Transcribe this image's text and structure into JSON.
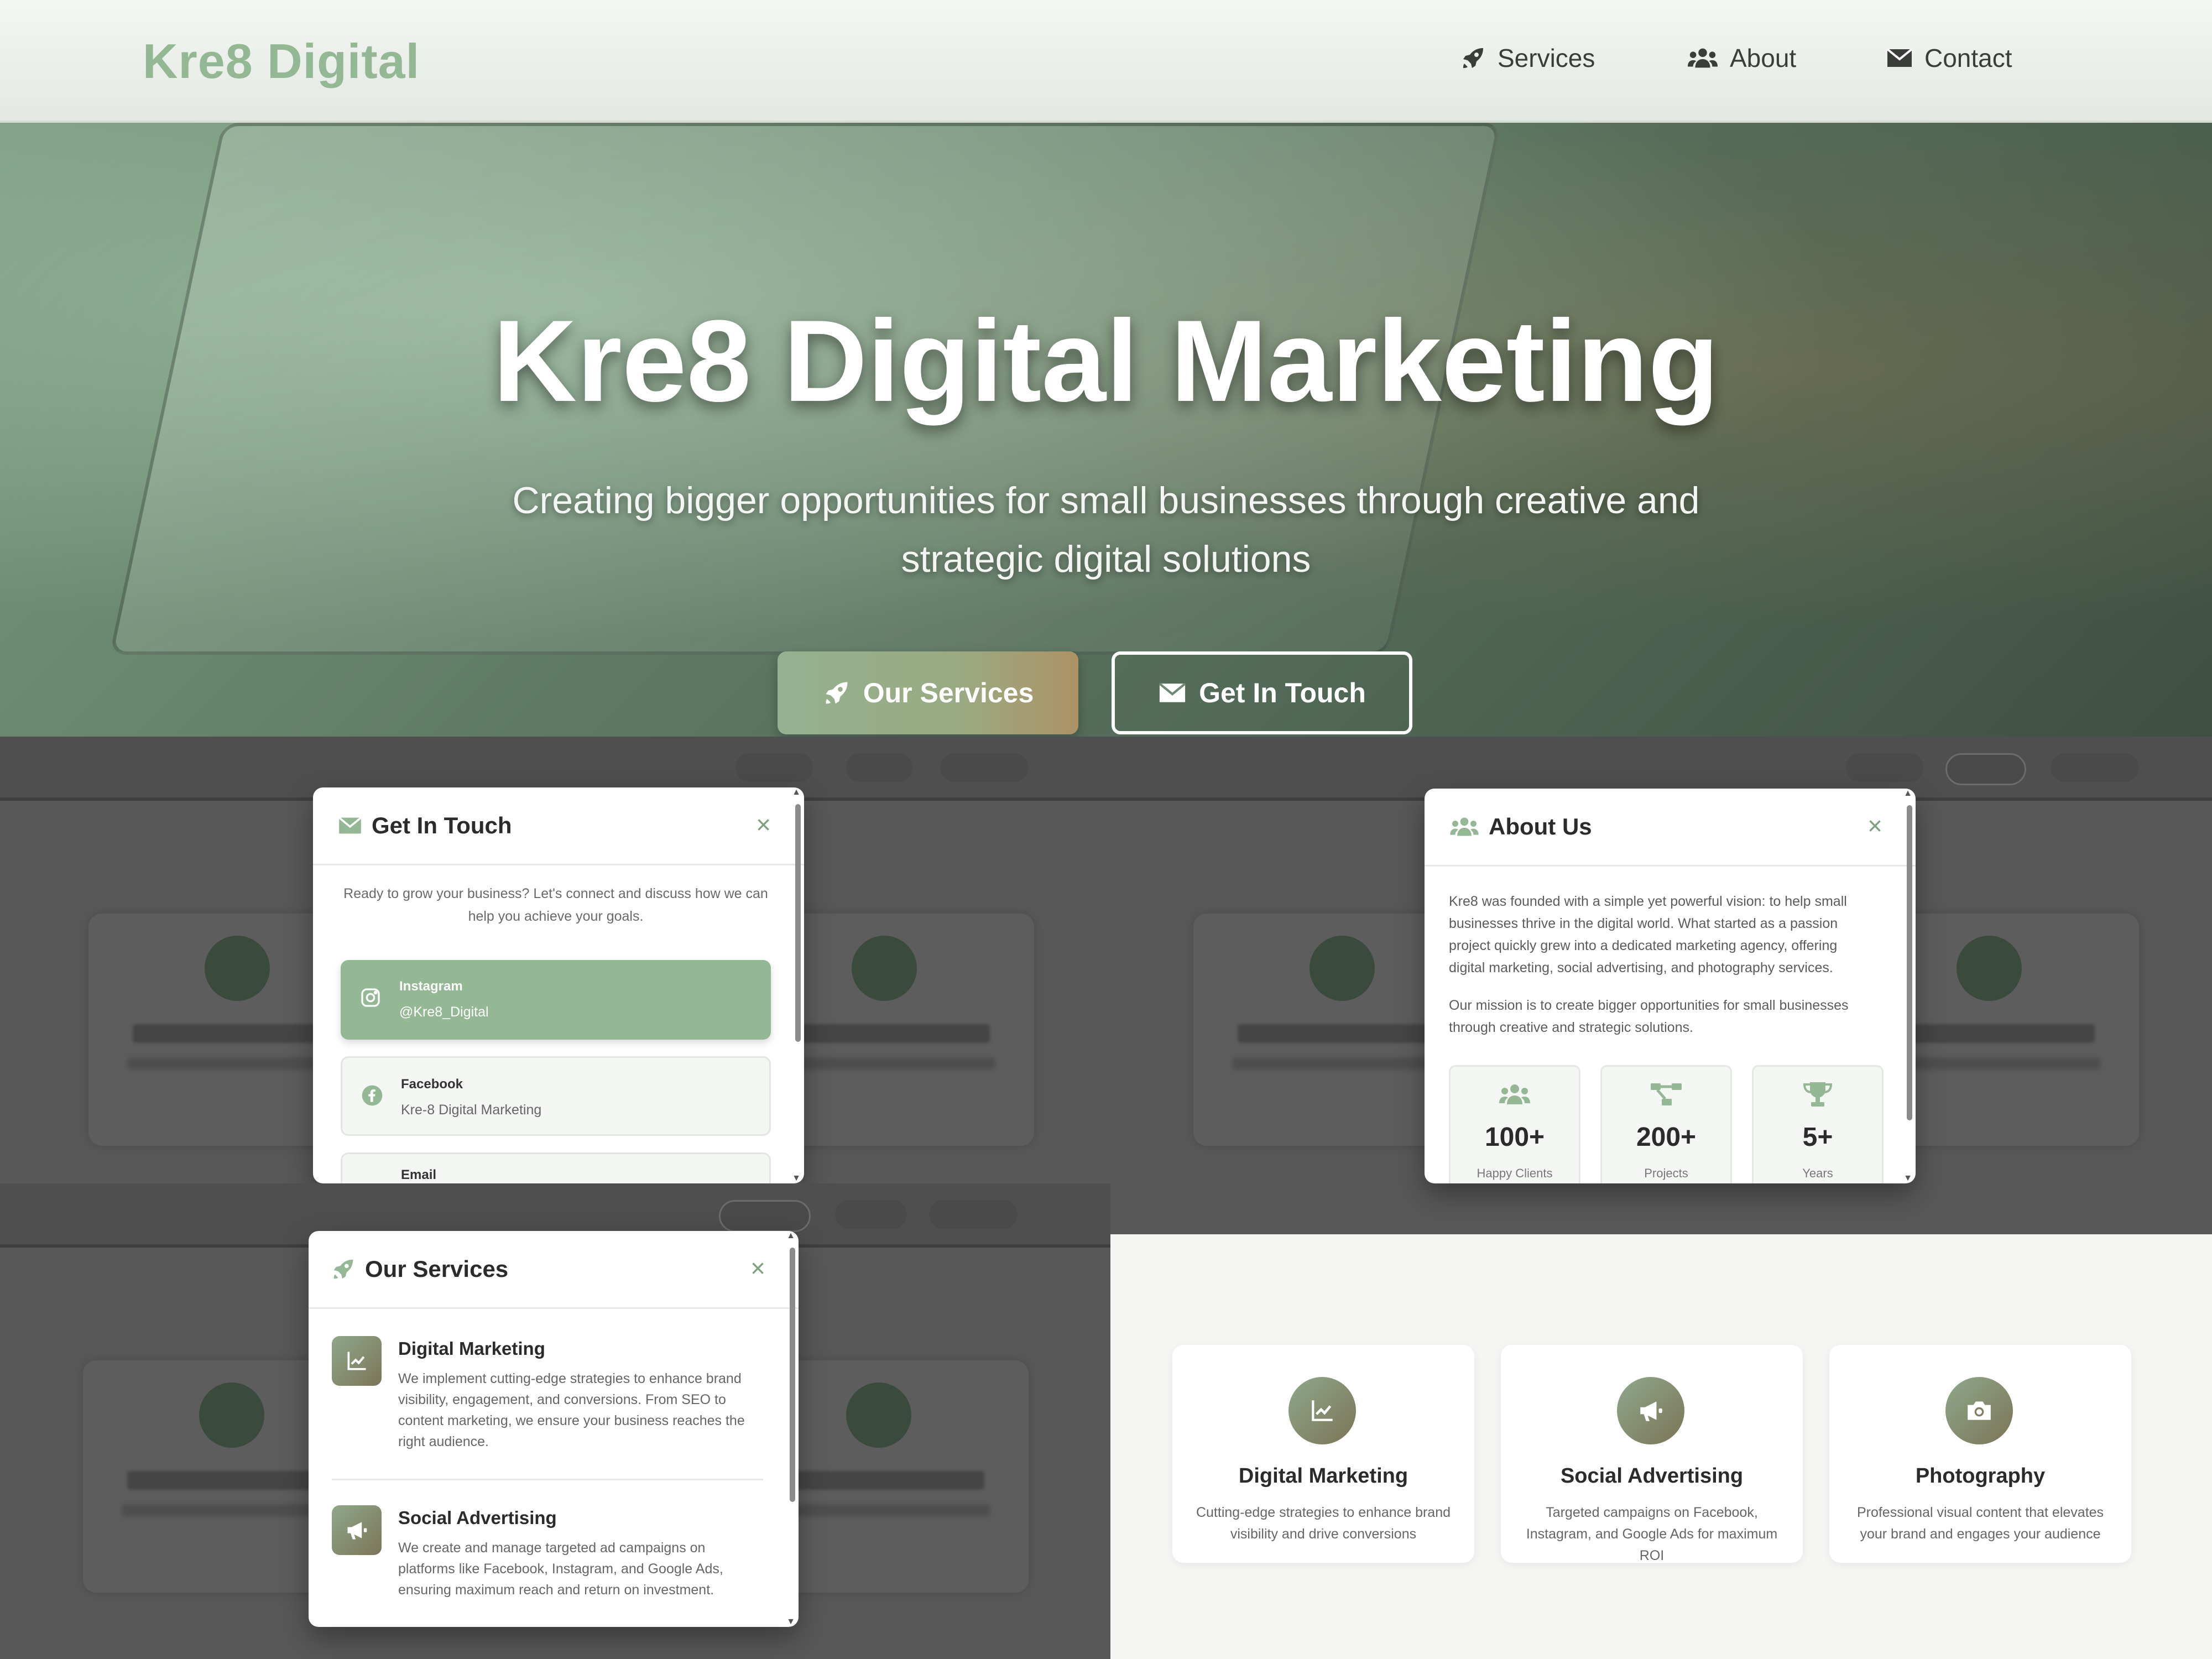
{
  "brand": {
    "logo": "Kre8 Digital"
  },
  "nav": {
    "services": "Services",
    "about": "About",
    "contact": "Contact"
  },
  "hero": {
    "title": "Kre8 Digital Marketing",
    "subtitle": "Creating bigger opportunities for small businesses through creative and strategic digital solutions",
    "primary_button": "Our Services",
    "secondary_button": "Get In Touch"
  },
  "contact_modal": {
    "title": "Get In Touch",
    "close": "×",
    "intro": "Ready to grow your business? Let's connect and discuss how we can help you achieve your goals.",
    "items": [
      {
        "label": "Instagram",
        "value": "@Kre8_Digital",
        "icon": "instagram-icon"
      },
      {
        "label": "Facebook",
        "value": "Kre-8 Digital Marketing",
        "icon": "facebook-icon"
      },
      {
        "label": "Email",
        "value": "",
        "icon": "email-icon"
      }
    ]
  },
  "about_modal": {
    "title": "About Us",
    "close": "×",
    "paragraph1": "Kre8 was founded with a simple yet powerful vision: to help small businesses thrive in the digital world. What started as a passion project quickly grew into a dedicated marketing agency, offering digital marketing, social advertising, and photography services.",
    "paragraph2": "Our mission is to create bigger opportunities for small businesses through creative and strategic solutions.",
    "stats": [
      {
        "number": "100+",
        "label": "Happy Clients",
        "icon": "users-icon"
      },
      {
        "number": "200+",
        "label": "Projects",
        "icon": "project-diagram-icon"
      },
      {
        "number": "5+",
        "label": "Years",
        "icon": "trophy-icon"
      }
    ]
  },
  "services_modal": {
    "title": "Our Services",
    "close": "×",
    "items": [
      {
        "title": "Digital Marketing",
        "description": "We implement cutting-edge strategies to enhance brand visibility, engagement, and conversions. From SEO to content marketing, we ensure your business reaches the right audience.",
        "icon": "chart-line-icon"
      },
      {
        "title": "Social Advertising",
        "description": "We create and manage targeted ad campaigns on platforms like Facebook, Instagram, and Google Ads, ensuring maximum reach and return on investment.",
        "icon": "megaphone-icon"
      }
    ]
  },
  "services_section": {
    "cards": [
      {
        "title": "Digital Marketing",
        "description": "Cutting-edge strategies to enhance brand visibility and drive conversions",
        "icon": "chart-line-icon"
      },
      {
        "title": "Social Advertising",
        "description": "Targeted campaigns on Facebook, Instagram, and Google Ads for maximum ROI",
        "icon": "megaphone-icon"
      },
      {
        "title": "Photography",
        "description": "Professional visual content that elevates your brand and engages your audience",
        "icon": "camera-icon"
      }
    ]
  },
  "colors": {
    "brand_green": "#93b893",
    "icon_gradient_start": "#8fa88a",
    "icon_gradient_end": "#7c7458",
    "dark_text": "#2b2b2b"
  }
}
